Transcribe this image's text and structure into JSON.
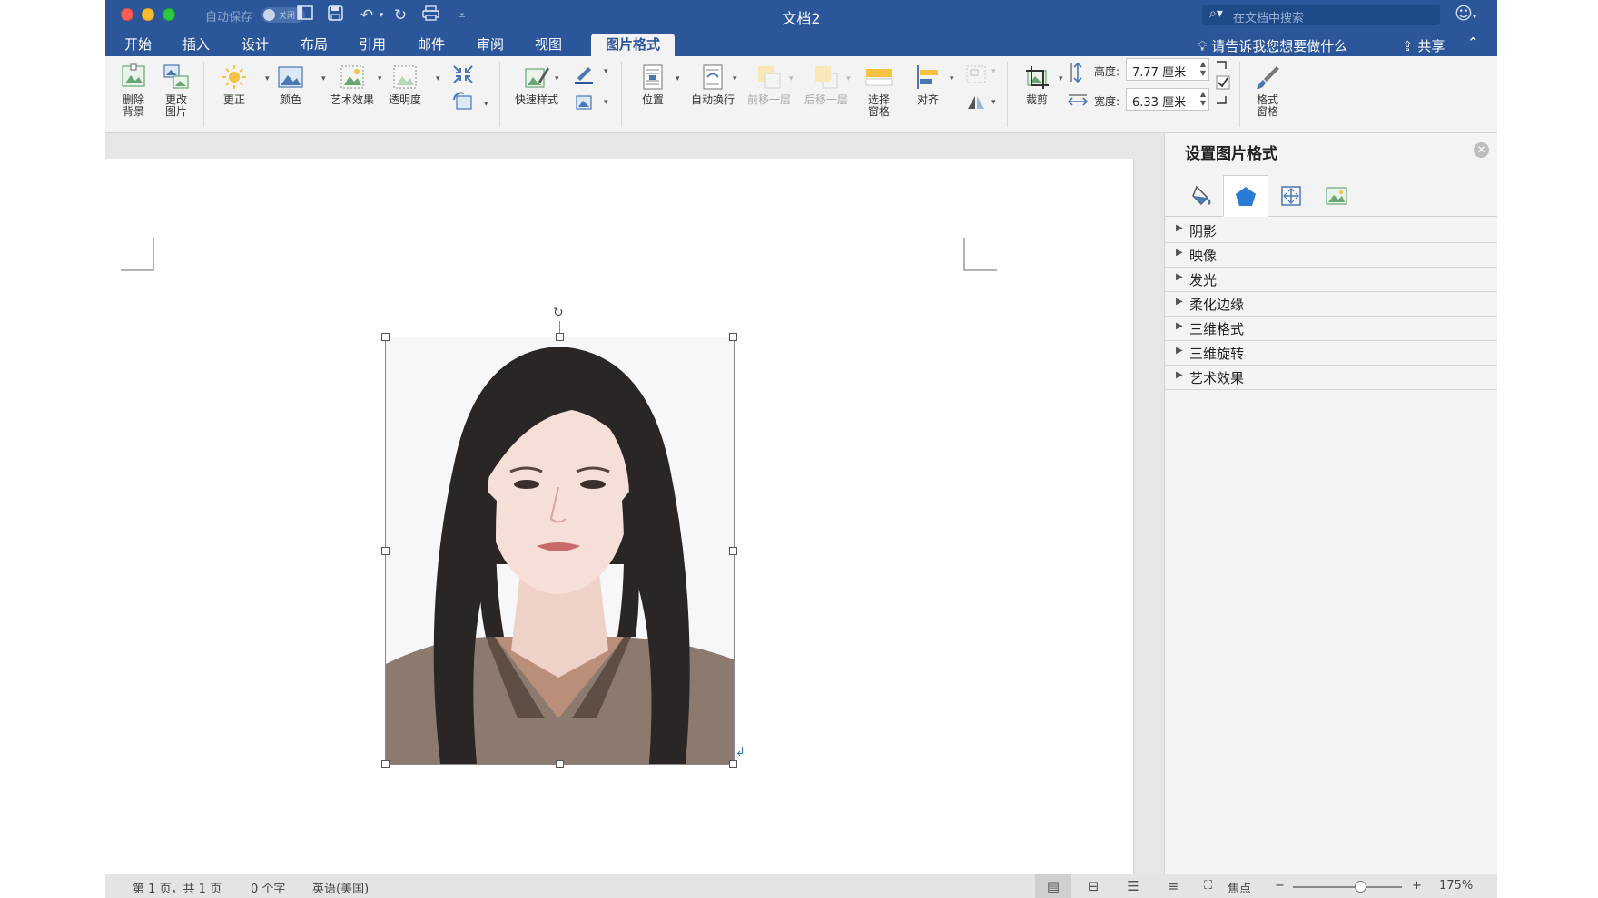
{
  "titlebar": {
    "autosave_label": "自动保存",
    "autosave_toggle": "关闭",
    "doc_title": "文档2",
    "search_placeholder": "在文档中搜索"
  },
  "tabs": [
    {
      "label": "开始",
      "active": false
    },
    {
      "label": "插入",
      "active": false
    },
    {
      "label": "设计",
      "active": false
    },
    {
      "label": "布局",
      "active": false
    },
    {
      "label": "引用",
      "active": false
    },
    {
      "label": "邮件",
      "active": false
    },
    {
      "label": "审阅",
      "active": false
    },
    {
      "label": "视图",
      "active": false
    },
    {
      "label": "图片格式",
      "active": true
    }
  ],
  "tellme": "请告诉我您想要做什么",
  "share": "共享",
  "ribbon": {
    "remove_bg": [
      "删除",
      "背景"
    ],
    "change_pic": [
      "更改",
      "图片"
    ],
    "corrections": "更正",
    "color": "颜色",
    "artistic": "艺术效果",
    "transparency": "透明度",
    "quick_styles": "快速样式",
    "position": "位置",
    "wrap_text": "自动换行",
    "bring_forward": "前移一层",
    "send_backward": "后移一层",
    "selection_pane": [
      "选择",
      "窗格"
    ],
    "align": "对齐",
    "crop": "裁剪",
    "height_label": "高度:",
    "height_value": "7.77 厘米",
    "width_label": "宽度:",
    "width_value": "6.33 厘米",
    "format_pane": [
      "格式",
      "窗格"
    ]
  },
  "pane": {
    "title": "设置图片格式",
    "tab_icons": [
      "fill-line-icon",
      "effects-icon",
      "layout-properties-icon",
      "picture-icon"
    ],
    "active_tab": 1,
    "sections": [
      "阴影",
      "映像",
      "发光",
      "柔化边缘",
      "三维格式",
      "三维旋转",
      "艺术效果"
    ]
  },
  "status": {
    "page": "第 1 页，共 1 页",
    "words": "0 个字",
    "language": "英语(美国)",
    "focus": "焦点",
    "zoom": "175%"
  },
  "colors": {
    "brand": "#2b579a",
    "ribbon_bg": "#f3f3f3",
    "selection_frame": "#8a8a8a"
  }
}
